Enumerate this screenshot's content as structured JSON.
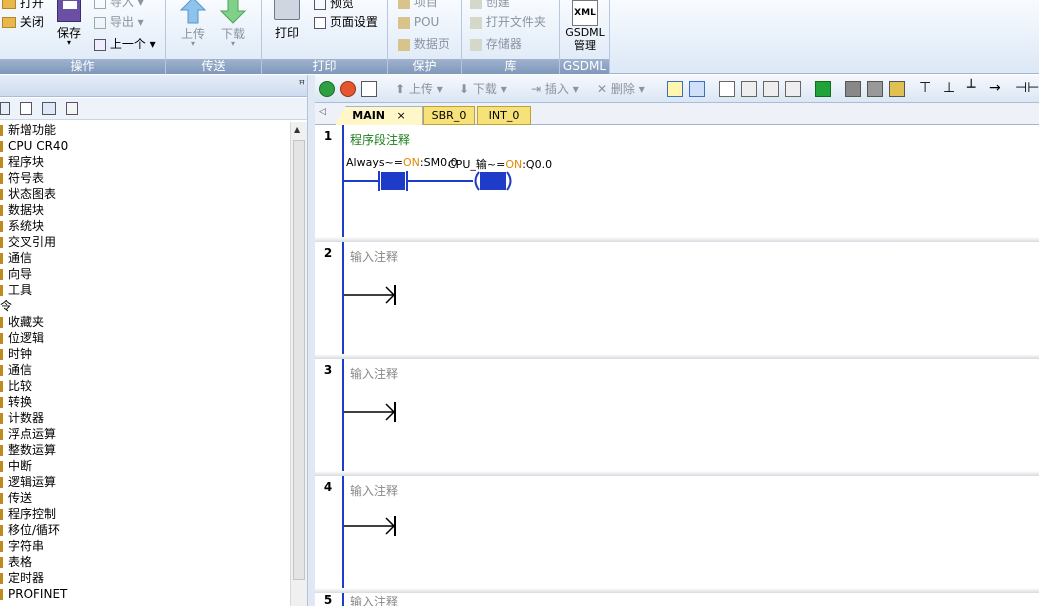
{
  "ribbon": {
    "groups": [
      {
        "label": "操作"
      },
      {
        "label": "传送"
      },
      {
        "label": "打印"
      },
      {
        "label": "保护"
      },
      {
        "label": "库"
      },
      {
        "label": "GSDML"
      }
    ],
    "open_label": "打开",
    "close_label": "关闭",
    "save_label": "保存",
    "import_label": "导入",
    "export_label": "导出",
    "prev_label": "上一个",
    "upload_label": "上传",
    "download_label": "下载",
    "print_label": "打印",
    "preview_label": "预览",
    "page_setup_label": "页面设置",
    "project_label": "项目",
    "pou_label": "POU",
    "data_page_label": "数据页",
    "create_label": "创建",
    "open_folder_label": "打开文件夹",
    "memory_label": "存储器",
    "gsdml_icon_text": "XML",
    "gsdml_label": "GSDML\n管理"
  },
  "left_panel": {
    "pin": "ꟸ",
    "tree_items": [
      "新增功能",
      "CPU CR40",
      "程序块",
      "符号表",
      "状态图表",
      "数据块",
      "系统块",
      "交叉引用",
      "通信",
      "向导",
      "工具",
      "令",
      "收藏夹",
      "位逻辑",
      "时钟",
      "通信",
      "比较",
      "转换",
      "计数器",
      "浮点运算",
      "整数运算",
      "中断",
      "逻辑运算",
      "传送",
      "程序控制",
      "移位/循环",
      "字符串",
      "表格",
      "定时器",
      "PROFINET"
    ]
  },
  "editor": {
    "toolbar": {
      "upload_label": "上传",
      "download_label": "下载",
      "insert_label": "插入",
      "delete_label": "删除"
    },
    "tabs": [
      {
        "label": "MAIN",
        "close": "×"
      },
      {
        "label": "SBR_0"
      },
      {
        "label": "INT_0"
      }
    ],
    "networks": [
      {
        "num": "1",
        "comment": "程序段注释",
        "contact": {
          "sym1": "Always~",
          "eq": "=",
          "on": "ON",
          "addr": ":SM0.0"
        },
        "coil": {
          "sym1": "CPU_输~",
          "eq": "=",
          "on": "ON",
          "addr": ":Q0.0"
        }
      },
      {
        "num": "2",
        "comment": "输入注释"
      },
      {
        "num": "3",
        "comment": "输入注释"
      },
      {
        "num": "4",
        "comment": "输入注释"
      },
      {
        "num": "5",
        "comment": "输入注释"
      }
    ]
  },
  "colors": {
    "rail": "#1e3cc8",
    "on_text": "#e08a00",
    "comment_green": "#1a7f1a",
    "tab_main": "#fff7c8",
    "tab_other": "#f7e27a"
  }
}
